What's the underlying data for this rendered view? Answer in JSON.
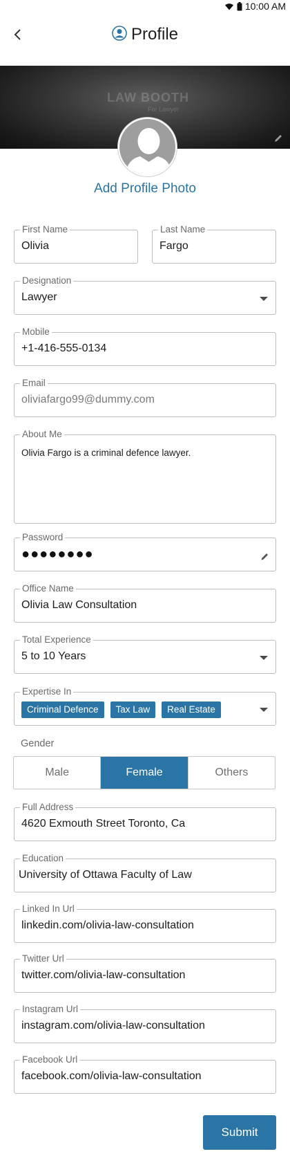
{
  "status_bar": {
    "time": "10:00 AM",
    "icons": [
      "wifi-icon",
      "battery-icon"
    ]
  },
  "header": {
    "title": "Profile",
    "back_icon": "chevron-left-icon",
    "title_icon": "user-circle-icon"
  },
  "cover": {
    "brand": "LAW BOOTH",
    "brand_sub": "For Lawyer",
    "edit_icon": "pencil-icon"
  },
  "avatar": {
    "action_label": "Add Profile Photo"
  },
  "form": {
    "first_name": {
      "label": "First Name",
      "value": "Olivia"
    },
    "last_name": {
      "label": "Last Name",
      "value": "Fargo"
    },
    "designation": {
      "label": "Designation",
      "value": "Lawyer"
    },
    "mobile": {
      "label": "Mobile",
      "value": "+1-416-555-0134"
    },
    "email": {
      "label": "Email",
      "value": "oliviafargo99@dummy.com"
    },
    "about": {
      "label": "About Me",
      "value": "Olivia Fargo is a criminal defence lawyer."
    },
    "password": {
      "label": "Password",
      "value": "●●●●●●●●"
    },
    "office_name": {
      "label": "Office Name",
      "value": "Olivia Law Consultation"
    },
    "experience": {
      "label": "Total Experience",
      "value": "5 to 10 Years"
    },
    "expertise": {
      "label": "Expertise In",
      "chips": [
        "Criminal Defence",
        "Tax Law",
        "Real Estate"
      ]
    },
    "gender": {
      "label": "Gender",
      "options": [
        "Male",
        "Female",
        "Others"
      ],
      "selected": "Female"
    },
    "address": {
      "label": "Full Address",
      "value": "4620  Exmouth Street Toronto, Ca"
    },
    "education": {
      "label": "Education",
      "value": "University of Ottawa Faculty of Law"
    },
    "linkedin": {
      "label": "Linked In Url",
      "value": "linkedin.com/olivia-law-consultation"
    },
    "twitter": {
      "label": "Twitter Url",
      "value": "twitter.com/olivia-law-consultation"
    },
    "instagram": {
      "label": "Instagram Url",
      "value": "instagram.com/olivia-law-consultation"
    },
    "facebook": {
      "label": "Facebook Url",
      "value": "facebook.com/olivia-law-consultation"
    }
  },
  "submit_label": "Submit",
  "colors": {
    "accent": "#2b74a6",
    "border": "#bdbdbd",
    "label": "#6b6b6b"
  }
}
